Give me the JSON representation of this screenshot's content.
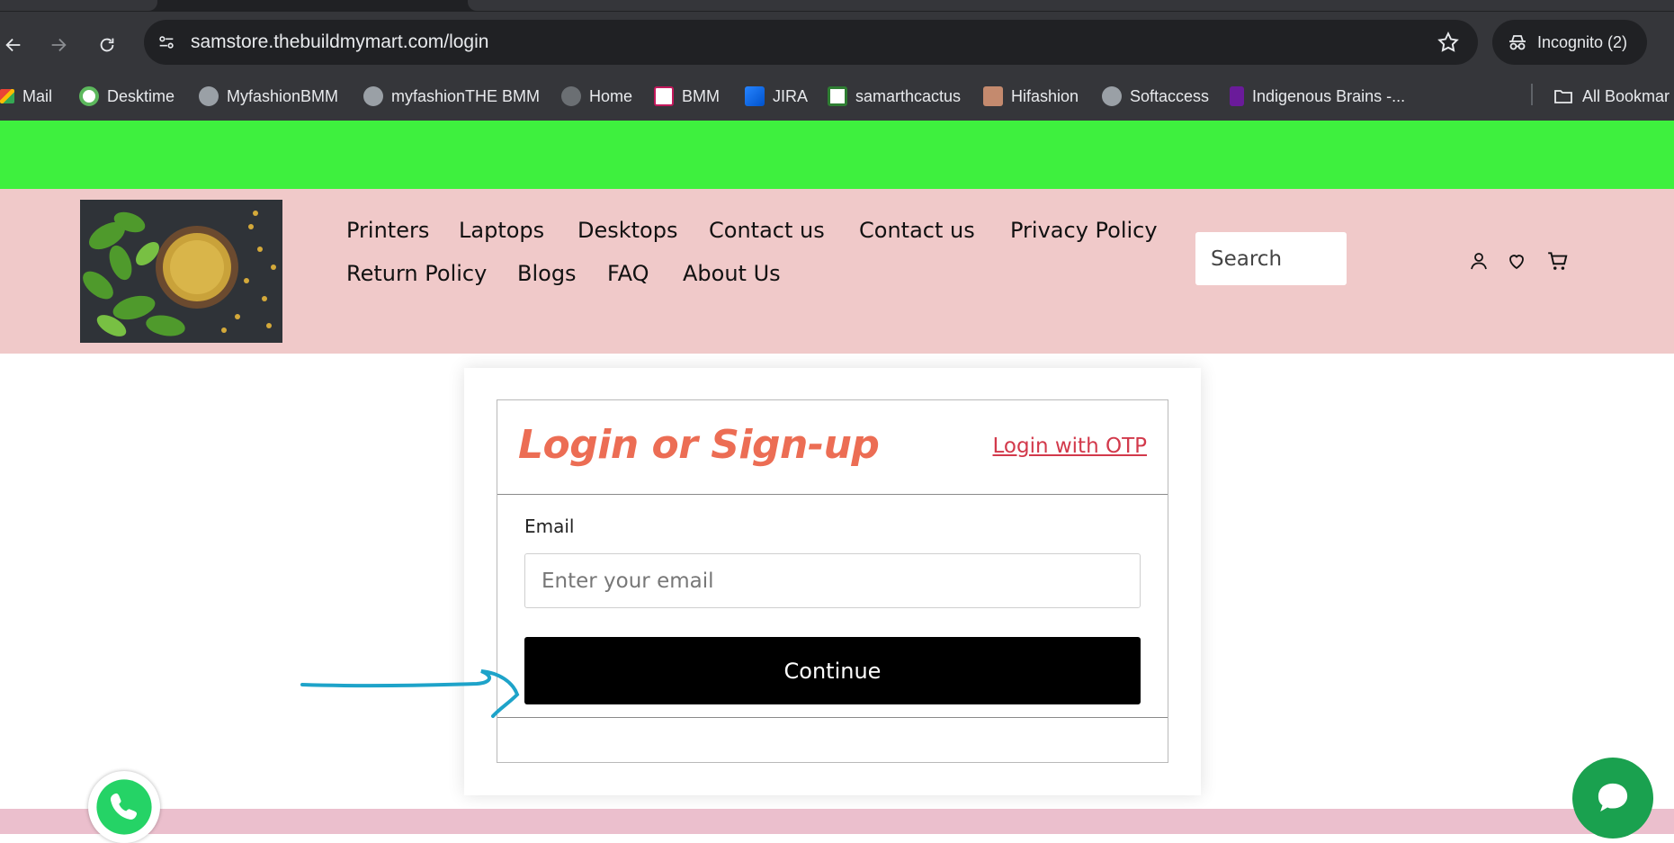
{
  "browser": {
    "url": "samstore.thebuildmymart.com/login",
    "incognito_label": "Incognito (2)",
    "bookmarks": [
      {
        "label": "Mail",
        "icon": "gmail-icon"
      },
      {
        "label": "Desktime",
        "icon": "desktime-icon"
      },
      {
        "label": "MyfashionBMM",
        "icon": "globe-icon"
      },
      {
        "label": "myfashionTHE BMM",
        "icon": "globe-icon"
      },
      {
        "label": "Home",
        "icon": "globe-icon"
      },
      {
        "label": "BMM",
        "icon": "bmm-icon"
      },
      {
        "label": "JIRA",
        "icon": "jira-icon"
      },
      {
        "label": "samarthcactus",
        "icon": "samarthcactus-icon"
      },
      {
        "label": "Hifashion",
        "icon": "hifashion-icon"
      },
      {
        "label": "Softaccess",
        "icon": "globe-icon"
      },
      {
        "label": "Indigenous Brains -...",
        "icon": "indigenous-icon"
      }
    ],
    "all_bookmarks_label": "All Bookmar"
  },
  "header": {
    "nav": [
      "Printers",
      "Laptops",
      "Desktops",
      "Contact us",
      "Contact us",
      "Privacy Policy",
      "Return Policy",
      "Blogs",
      "FAQ",
      "About Us"
    ],
    "search_placeholder": "Search"
  },
  "login": {
    "title": "Login or Sign-up",
    "otp_link": "Login with OTP",
    "email_label": "Email",
    "email_placeholder": "Enter your email",
    "email_value": "",
    "continue_label": "Continue"
  },
  "colors": {
    "announce_bar": "#3ef03e",
    "header_bg": "#f0c9c9",
    "title": "#ec6d54",
    "otp_link": "#d2394b",
    "annotation_arrow": "#1ea3c9"
  }
}
